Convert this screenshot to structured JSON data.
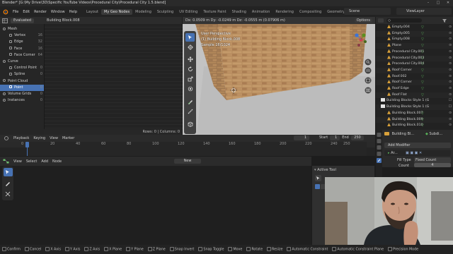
{
  "window": {
    "title": "Blender* [G:\\My Drive\\3D\\Specific YouTube Videos\\Procedural City\\Procedural City 1.5.blend]",
    "controls": [
      "–",
      "□",
      "✕"
    ]
  },
  "menu": {
    "items": [
      "File",
      "Edit",
      "Render",
      "Window",
      "Help"
    ],
    "workspaces": [
      "Layout",
      "My Geo Nodes",
      "Modeling",
      "Sculpting",
      "UV Editing",
      "Texture Paint",
      "Shading",
      "Animation",
      "Rendering",
      "Compositing",
      "Geometry Nodes",
      "Sc"
    ],
    "active_workspace": "My Geo Nodes",
    "scene": "Scene",
    "view_layer": "ViewLayer"
  },
  "spreadsheet": {
    "mode": "Evaluated",
    "object": "Building Block.008",
    "domains": [
      {
        "label": "Mesh",
        "count": "",
        "indent": 0
      },
      {
        "label": "Vertex",
        "count": "16",
        "indent": 1
      },
      {
        "label": "Edge",
        "count": "32",
        "indent": 1
      },
      {
        "label": "Face",
        "count": "16",
        "indent": 1
      },
      {
        "label": "Face Corner",
        "count": "64",
        "indent": 1
      },
      {
        "label": "Curve",
        "count": "",
        "indent": 0
      },
      {
        "label": "Control Point",
        "count": "0",
        "indent": 1
      },
      {
        "label": "Spline",
        "count": "0",
        "indent": 1
      },
      {
        "label": "Point Cloud",
        "count": "",
        "indent": 0
      },
      {
        "label": "Point",
        "count": "0",
        "indent": 1,
        "selected": true
      },
      {
        "label": "Volume Grids",
        "count": "0",
        "indent": 0
      },
      {
        "label": "Instances",
        "count": "0",
        "indent": 0
      }
    ],
    "footer": "Rows: 0  |  Columns: 0"
  },
  "viewport": {
    "header": "Dx: 0.0509 m  Dy: -0.0249 m  Dz: -0.0555 m (0.07906 m)",
    "options": "Options",
    "info": [
      "User Perspective",
      "(1) Building Block.008",
      "Sample 16/1024"
    ]
  },
  "outliner": {
    "rows": [
      {
        "label": "Empty.004",
        "color": "#d9a13a",
        "indent": 1,
        "right": "⊙"
      },
      {
        "label": "Empty.005",
        "color": "#d9a13a",
        "indent": 1,
        "right": "⊙"
      },
      {
        "label": "Empty.008",
        "color": "#d9a13a",
        "indent": 1,
        "right": "⊙"
      },
      {
        "label": "Plane",
        "color": "#d9a13a",
        "indent": 1,
        "right": "⊙"
      },
      {
        "label": "Procedural City.001",
        "color": "#d9a13a",
        "indent": 1,
        "right": "⊙"
      },
      {
        "label": "Procedural City.003",
        "color": "#d9a13a",
        "indent": 1,
        "right": "⊙"
      },
      {
        "label": "Procedural City.004",
        "color": "#d9a13a",
        "indent": 1,
        "right": "⊙"
      },
      {
        "label": "Roof Corner",
        "color": "#d9a13a",
        "indent": 1,
        "right": "⊙"
      },
      {
        "label": "Roof.002",
        "color": "#d9a13a",
        "indent": 1,
        "right": "⊙"
      },
      {
        "label": "Roof Corner",
        "color": "#d9a13a",
        "indent": 1,
        "right": "⊙"
      },
      {
        "label": "Roof Edge",
        "color": "#d9a13a",
        "indent": 1,
        "right": "⊙"
      },
      {
        "label": "Roof Flat",
        "color": "#d9a13a",
        "indent": 1,
        "right": "⊙"
      },
      {
        "label": "Building Blocks Style 1 (G",
        "color": "#e5e5e5",
        "indent": 0,
        "right": "☐"
      },
      {
        "label": "Building Blocks Style 1 (G",
        "color": "#e5e5e5",
        "indent": 0,
        "right": "☐"
      },
      {
        "label": "Building Block.007",
        "color": "#d9a13a",
        "indent": 1,
        "right": "⊙"
      },
      {
        "label": "Building Block.009",
        "color": "#d9a13a",
        "indent": 1,
        "right": "⊙"
      },
      {
        "label": "Building Block.010",
        "color": "#d9a13a",
        "indent": 1,
        "right": "⊙"
      }
    ]
  },
  "properties": {
    "object": "Building Bl...",
    "modifier_name": "Subdi...",
    "add_modifier": "Add Modifier",
    "modifier_short": "Ar...",
    "fill_type_label": "Fill Type",
    "fill_type_value": "Fixed Count",
    "count_label": "Count",
    "count_value": "4"
  },
  "timeline": {
    "menus": [
      "Playback",
      "Keying",
      "View",
      "Marker"
    ],
    "current_frame": "1",
    "start_label": "Start",
    "start": "1",
    "end_label": "End",
    "end": "250",
    "ticks": [
      "0",
      "20",
      "40",
      "60",
      "80",
      "100",
      "120",
      "140",
      "160",
      "180",
      "200",
      "220",
      "240",
      "250"
    ]
  },
  "node_editor": {
    "menus": [
      "View",
      "Select",
      "Add",
      "Node"
    ],
    "new_button": "New"
  },
  "active_tool": {
    "title": "Active Tool"
  },
  "statusbar": {
    "items": [
      "Confirm",
      "Cancel",
      "X Axis",
      "Y Axis",
      "Z Axis",
      "X Plane",
      "Y Plane",
      "Z Plane",
      "Snap Invert",
      "Snap Toggle",
      "Move",
      "Rotate",
      "Resize",
      "Automatic Constraint",
      "Automatic Constraint Plane",
      "Precision Mode"
    ]
  },
  "colors": {
    "accent": "#4772b3",
    "object_orange": "#d9a13a",
    "modifier_green": "#5ab35a"
  },
  "icons": [
    "blender-logo-icon",
    "editor-type-icon",
    "cursor-icon",
    "move-icon",
    "rotate-icon",
    "scale-icon",
    "transform-icon",
    "annotate-icon",
    "measure-icon",
    "zoom-icon",
    "hand-icon",
    "camera-icon",
    "grid-icon",
    "funnel-icon",
    "wrench-icon",
    "eye-icon"
  ]
}
